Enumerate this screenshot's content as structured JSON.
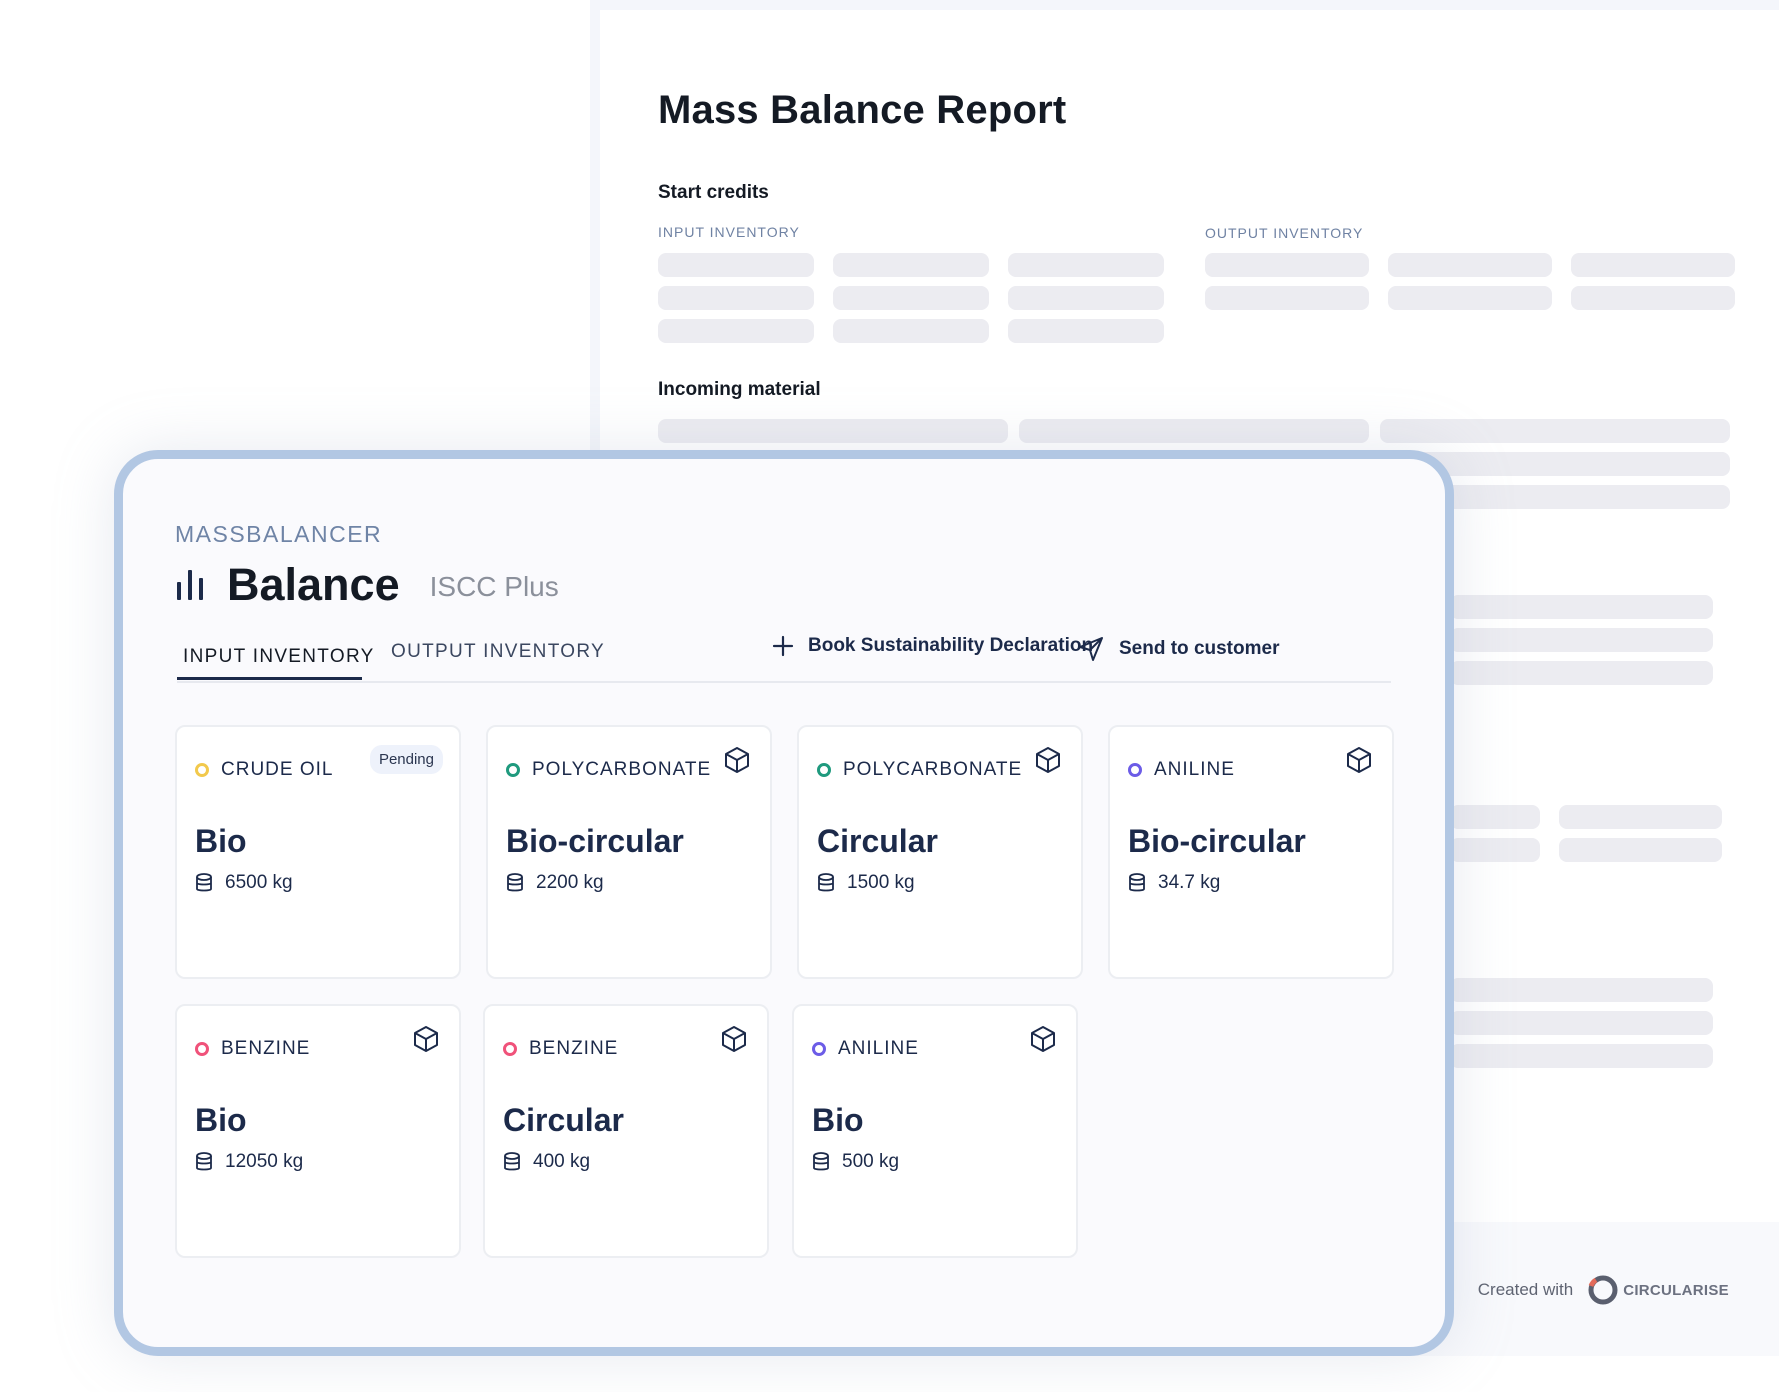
{
  "report": {
    "title": "Mass Balance Report",
    "section_start_credits": "Start credits",
    "input_inventory_label": "INPUT INVENTORY",
    "output_inventory_label": "OUTPUT INVENTORY",
    "section_incoming_material": "Incoming material",
    "footer": {
      "created_with": "Created with",
      "brand": "CIRCULARISE"
    }
  },
  "app": {
    "label": "MASSBALANCER",
    "title": "Balance",
    "subtitle": "ISCC Plus",
    "tabs": [
      {
        "label": "INPUT INVENTORY",
        "active": true
      },
      {
        "label": "OUTPUT INVENTORY",
        "active": false
      }
    ],
    "actions": {
      "book_label": "Book Sustainability Declaration",
      "send_label": "Send to customer"
    },
    "cards": [
      {
        "material": "CRUDE OIL",
        "dot_color": "#f2c94c",
        "badge": "Pending",
        "type": "Bio",
        "quantity": "6500 kg"
      },
      {
        "material": "POLYCARBONATE",
        "dot_color": "#1f9a7e",
        "badge": null,
        "type": "Bio-circular",
        "quantity": "2200 kg"
      },
      {
        "material": "POLYCARBONATE",
        "dot_color": "#1f9a7e",
        "badge": null,
        "type": "Circular",
        "quantity": "1500 kg"
      },
      {
        "material": "ANILINE",
        "dot_color": "#6c5ce7",
        "badge": null,
        "type": "Bio-circular",
        "quantity": "34.7 kg"
      },
      {
        "material": "BENZINE",
        "dot_color": "#f0527a",
        "badge": null,
        "type": "Bio",
        "quantity": "12050 kg"
      },
      {
        "material": "BENZINE",
        "dot_color": "#f0527a",
        "badge": null,
        "type": "Circular",
        "quantity": "400 kg"
      },
      {
        "material": "ANILINE",
        "dot_color": "#6c5ce7",
        "badge": null,
        "type": "Bio",
        "quantity": "500 kg"
      }
    ]
  },
  "colors": {
    "panel_border": "#b2c7e3",
    "primary_text": "#1c2a4a",
    "placeholder": "#ececf1"
  }
}
